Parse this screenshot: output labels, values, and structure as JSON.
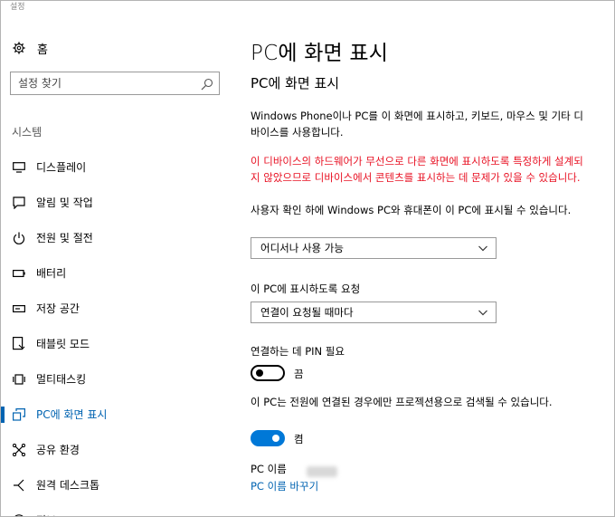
{
  "window": {
    "title": "설정"
  },
  "sidebar": {
    "home_label": "홈",
    "search_placeholder": "설정 찾기",
    "section_label": "시스템",
    "items": [
      {
        "label": "디스플레이",
        "icon": "monitor-icon"
      },
      {
        "label": "알림 및 작업",
        "icon": "notification-icon"
      },
      {
        "label": "전원 및 절전",
        "icon": "power-icon"
      },
      {
        "label": "배터리",
        "icon": "battery-icon"
      },
      {
        "label": "저장 공간",
        "icon": "storage-icon"
      },
      {
        "label": "태블릿 모드",
        "icon": "tablet-icon"
      },
      {
        "label": "멀티태스킹",
        "icon": "multitasking-icon"
      },
      {
        "label": "PC에 화면 표시",
        "icon": "project-icon",
        "active": true
      },
      {
        "label": "공유 환경",
        "icon": "shared-icon"
      },
      {
        "label": "원격 데스크톱",
        "icon": "remote-icon"
      },
      {
        "label": "정보",
        "icon": "info-icon"
      }
    ]
  },
  "main": {
    "page_title": "PC에 화면 표시",
    "section_title": "PC에 화면 표시",
    "description": "Windows Phone이나 PC를 이 화면에 표시하고, 키보드, 마우스 및 기타 디바이스를 사용합니다.",
    "warning": "이 디바이스의 하드웨어가 무선으로 다른 화면에 표시하도록 특정하게 설계되지 않았으므로 디바이스에서 콘텐츠를 표시하는 데 문제가 있을 수 있습니다.",
    "availability_label": "사용자 확인 하에 Windows PC와 휴대폰이 이 PC에 표시될 수 있습니다.",
    "availability_value": "어디서나 사용 가능",
    "request_label": "이 PC에 표시하도록 요청",
    "request_value": "연결이 요청될 때마다",
    "pin_label": "연결하는 데 PIN 필요",
    "pin_state": "끔",
    "power_label": "이 PC는 전원에 연결된 경우에만 프로젝션용으로 검색될 수 있습니다.",
    "power_state": "켬",
    "pc_name_label": "PC 이름",
    "rename_link": "PC 이름 바꾸기"
  },
  "colors": {
    "accent": "#0063b1",
    "toggle_on": "#0078d7",
    "warning": "#e81123"
  }
}
